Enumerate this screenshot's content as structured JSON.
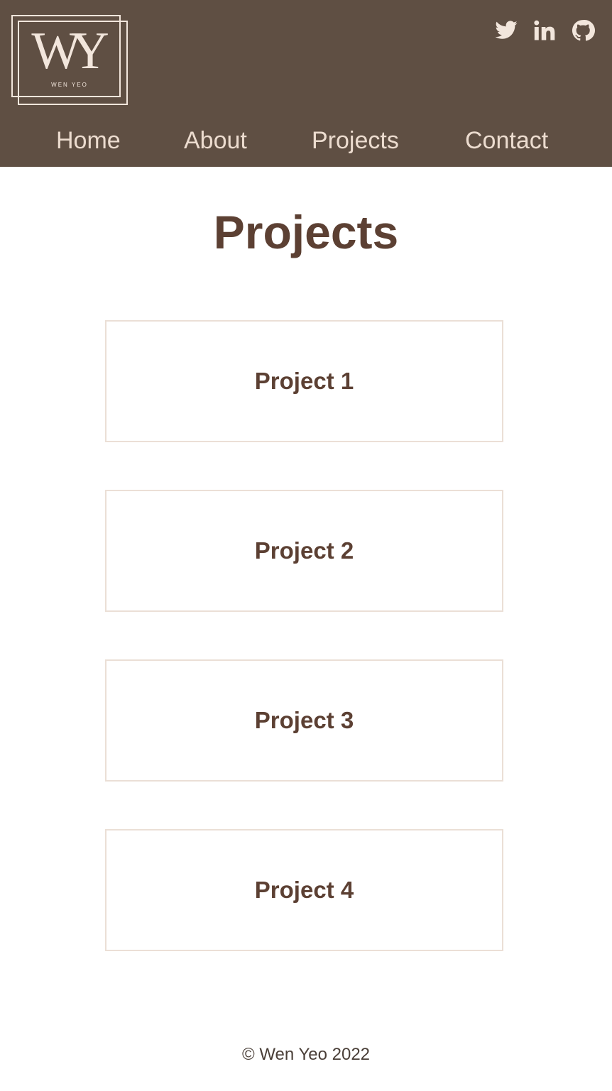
{
  "header": {
    "logo": {
      "monogram": "WY",
      "name": "WEN YEO"
    },
    "social": [
      {
        "icon": "twitter-icon"
      },
      {
        "icon": "linkedin-icon"
      },
      {
        "icon": "github-icon"
      }
    ],
    "nav": [
      {
        "label": "Home"
      },
      {
        "label": "About"
      },
      {
        "label": "Projects"
      },
      {
        "label": "Contact"
      }
    ]
  },
  "main": {
    "title": "Projects",
    "projects": [
      {
        "label": "Project 1"
      },
      {
        "label": "Project 2"
      },
      {
        "label": "Project 3"
      },
      {
        "label": "Project 4"
      }
    ]
  },
  "footer": {
    "text": "© Wen Yeo 2022"
  },
  "colors": {
    "header_bg": "#5f4f43",
    "nav_text": "#ecdccf",
    "accent_brown": "#5c4033",
    "card_border": "#ebdfd6"
  }
}
